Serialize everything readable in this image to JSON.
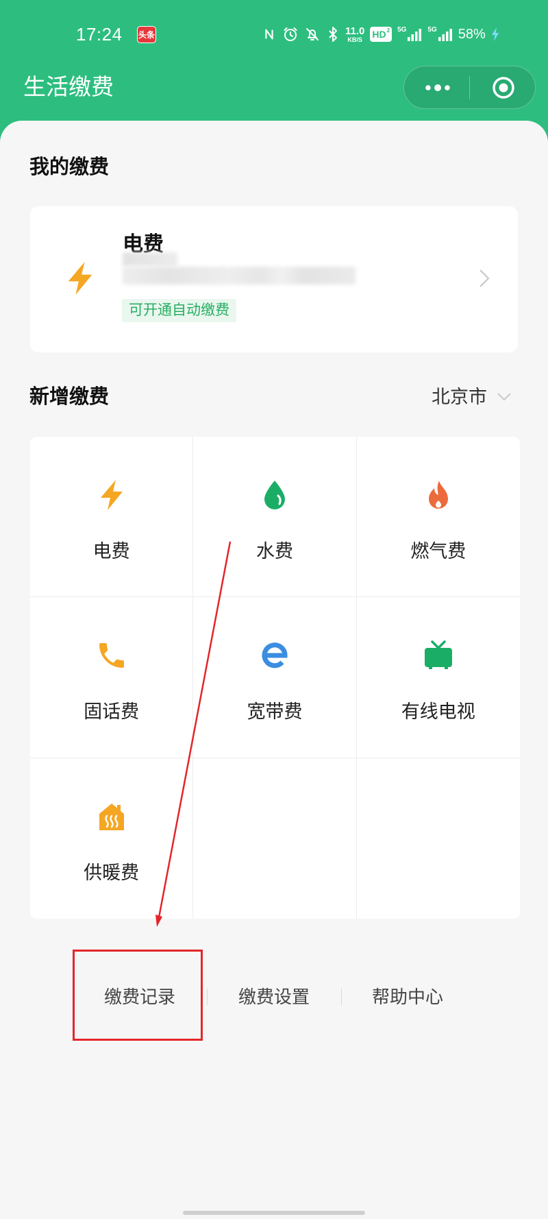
{
  "status_bar": {
    "time": "17:24",
    "app_badge": "头条",
    "net_speed": {
      "value": "11.0",
      "unit": "KB/S"
    },
    "hd": {
      "label": "HD",
      "sub": "2"
    },
    "sim1": {
      "label": "5G"
    },
    "sim2": {
      "label": "5G"
    },
    "battery": "58%",
    "icons": [
      "nfc-icon",
      "alarm-icon",
      "bell-off-icon",
      "bluetooth-icon",
      "signal-icon",
      "charging-icon"
    ]
  },
  "header": {
    "title": "生活缴费",
    "actions": [
      "more-dots-icon",
      "target-icon"
    ]
  },
  "my_bills": {
    "heading": "我的缴费",
    "cards": [
      {
        "title": "电费",
        "tag": "可开通自动缴费",
        "icon": "lightning-icon",
        "color": "#f5a623"
      }
    ]
  },
  "new_bills": {
    "heading": "新增缴费",
    "city": "北京市",
    "items": [
      {
        "label": "电费",
        "icon": "lightning-icon",
        "color": "#f5a623"
      },
      {
        "label": "水费",
        "icon": "water-drop-icon",
        "color": "#1aad66"
      },
      {
        "label": "燃气费",
        "icon": "flame-icon",
        "color": "#ec6b3c"
      },
      {
        "label": "固话费",
        "icon": "phone-icon",
        "color": "#f5a623"
      },
      {
        "label": "宽带费",
        "icon": "broadband-e-icon",
        "color": "#3b8de0"
      },
      {
        "label": "有线电视",
        "icon": "tv-icon",
        "color": "#1aad66"
      },
      {
        "label": "供暖费",
        "icon": "heating-icon",
        "color": "#f5a623"
      }
    ]
  },
  "footer_links": [
    {
      "label": "缴费记录"
    },
    {
      "label": "缴费设置"
    },
    {
      "label": "帮助中心"
    }
  ],
  "colors": {
    "brand": "#2dbe7f",
    "tag_text": "#27ae60",
    "tag_bg": "#eaf7ef",
    "annotation": "#e3262a",
    "page_bg": "#f6f6f6"
  }
}
